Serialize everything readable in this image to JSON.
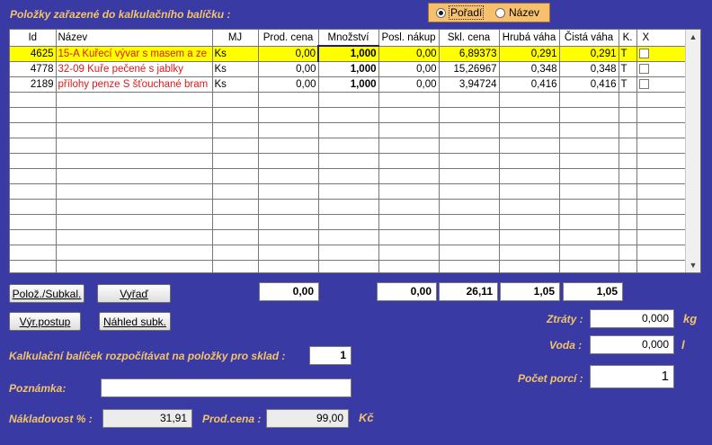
{
  "header": {
    "title": "Položky zařazené do kalkulačního balíčku :",
    "sort_options": [
      {
        "label": "Pořadí",
        "selected": true
      },
      {
        "label": "Název",
        "selected": false
      }
    ]
  },
  "grid": {
    "columns": [
      "Id",
      "Název",
      "MJ",
      "Prod. cena",
      "Množství",
      "Posl. nákup",
      "Skl. cena",
      "Hrubá váha",
      "Čistá váha",
      "K.",
      "X"
    ],
    "rows": [
      {
        "id": "4625",
        "name": "15-A Kuřecí vývar s masem a ze",
        "mj": "Ks",
        "prod_cena": "0,00",
        "mnozstvi": "1,000",
        "posl_nakup": "0,00",
        "skl_cena": "6,89373",
        "hruba_vaha": "0,291",
        "cista_vaha": "0,291",
        "k": "T",
        "x": false
      },
      {
        "id": "4778",
        "name": "32-09 Kuře pečené s jablky",
        "mj": "Ks",
        "prod_cena": "0,00",
        "mnozstvi": "1,000",
        "posl_nakup": "0,00",
        "skl_cena": "15,26967",
        "hruba_vaha": "0,348",
        "cista_vaha": "0,348",
        "k": "T",
        "x": false
      },
      {
        "id": "2189",
        "name": "přílohy penze S šťouchané bram",
        "mj": "Ks",
        "prod_cena": "0,00",
        "mnozstvi": "1,000",
        "posl_nakup": "0,00",
        "skl_cena": "3,94724",
        "hruba_vaha": "0,416",
        "cista_vaha": "0,416",
        "k": "T",
        "x": false
      }
    ],
    "colors": {
      "selected_row": "#ffff00",
      "name_text": "#e01818"
    },
    "scroll_up_icon": "triangle-up",
    "scroll_down_icon": "triangle-down"
  },
  "buttons": {
    "poloz_subkal": "Polož./Subkal.",
    "vyrad": "Vyřaď",
    "vyr_postup": "Výr.postup",
    "nahled_subk": "Náhled subk."
  },
  "totals": {
    "prod_cena": "0,00",
    "posl_nakup": "0,00",
    "skl_cena": "26,11",
    "hruba_vaha": "1,05",
    "cista_vaha": "1,05"
  },
  "form": {
    "sklad_label": "Kalkulační balíček rozpočítávat na položky pro sklad :",
    "sklad_value": "1",
    "poznamka_label": "Poznámka:",
    "poznamka_value": "",
    "nakladovost_label": "Nákladovost % :",
    "nakladovost_value": "31,91",
    "prodcena_label": "Prod.cena :",
    "prodcena_value": "99,00",
    "currency": "Kč",
    "ztraty_label": "Ztráty :",
    "ztraty_value": "0,000",
    "ztraty_unit": "kg",
    "voda_label": "Voda :",
    "voda_value": "0,000",
    "voda_unit": "l",
    "porce_label": "Počet porcí :",
    "porce_value": "1"
  },
  "colors": {
    "background": "#3a3aa5",
    "label": "#f2c46a",
    "radio_group": "#f6c06c"
  }
}
